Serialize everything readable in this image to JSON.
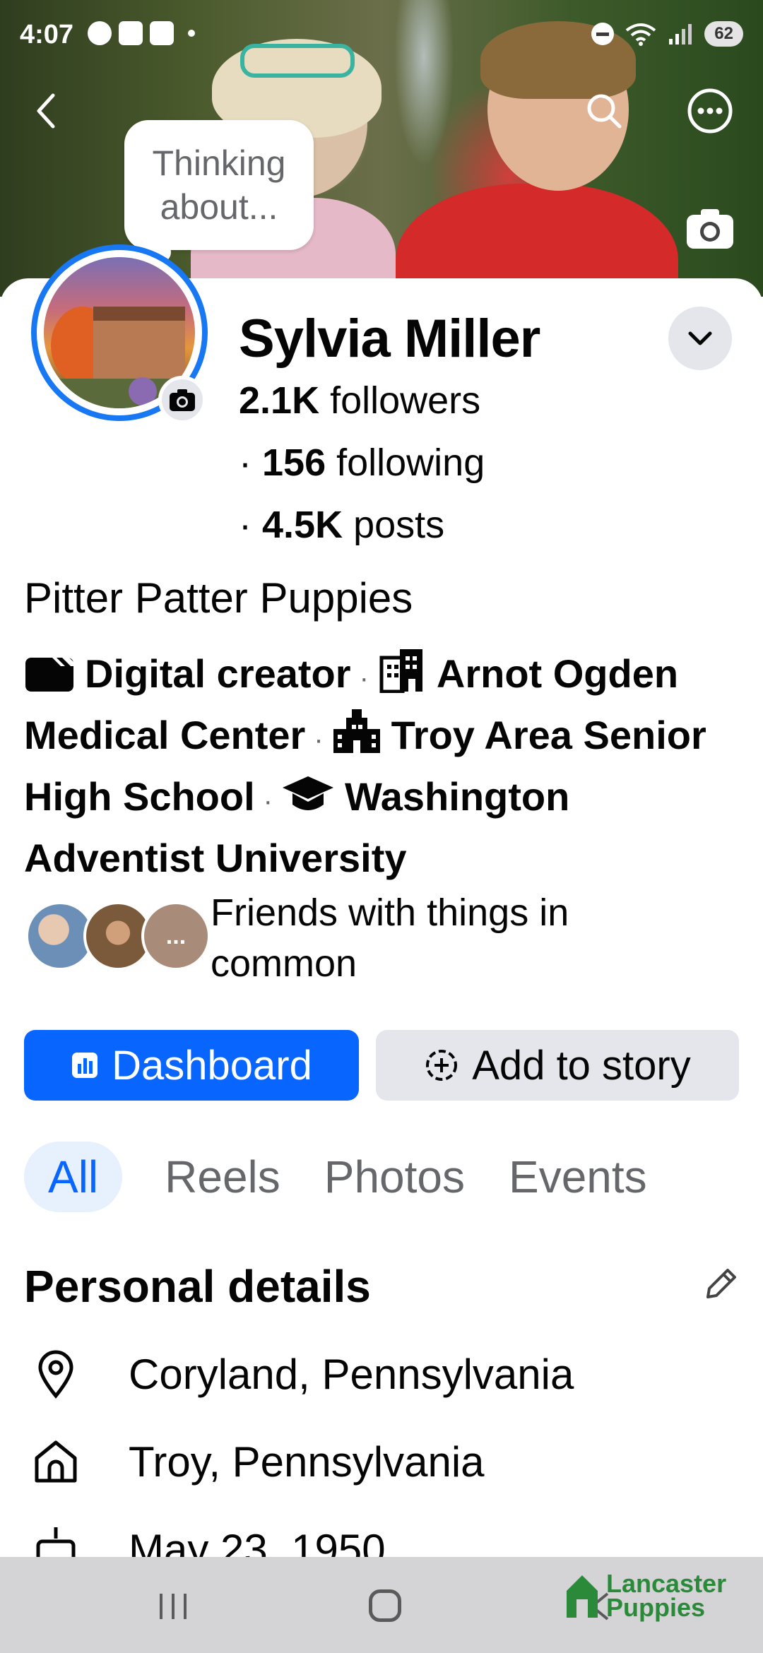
{
  "status_bar": {
    "time": "4:07",
    "battery": "62"
  },
  "cover": {
    "thought_bubble": "Thinking about..."
  },
  "profile": {
    "name": "Sylvia Miller",
    "followers_count": "2.1K",
    "followers_label": " followers",
    "following_count": "156",
    "following_label": " following",
    "posts_count": "4.5K",
    "posts_label": " posts",
    "page_name": "Pitter Patter Puppies"
  },
  "intro": {
    "role": "Digital creator",
    "workplace": "Arnot Ogden Medical Center",
    "high_school": "Troy Area Senior High School",
    "college": "Washington Adventist University",
    "separator": "·"
  },
  "friends": {
    "text": "Friends with things in common",
    "more": "..."
  },
  "actions": {
    "dashboard": "Dashboard",
    "add_story": "Add to story"
  },
  "tabs": [
    "All",
    "Reels",
    "Photos",
    "Events"
  ],
  "personal_details": {
    "title": "Personal details",
    "current_city": "Coryland, Pennsylvania",
    "hometown": "Troy, Pennsylvania",
    "birthday": "May 23, 1950"
  },
  "watermark": {
    "line1": "Lancaster",
    "line2": "Puppies"
  },
  "colors": {
    "accent": "#0866ff",
    "ring": "#1877f2",
    "secondary_text": "#65676b",
    "button_gray": "#e4e6eb"
  }
}
